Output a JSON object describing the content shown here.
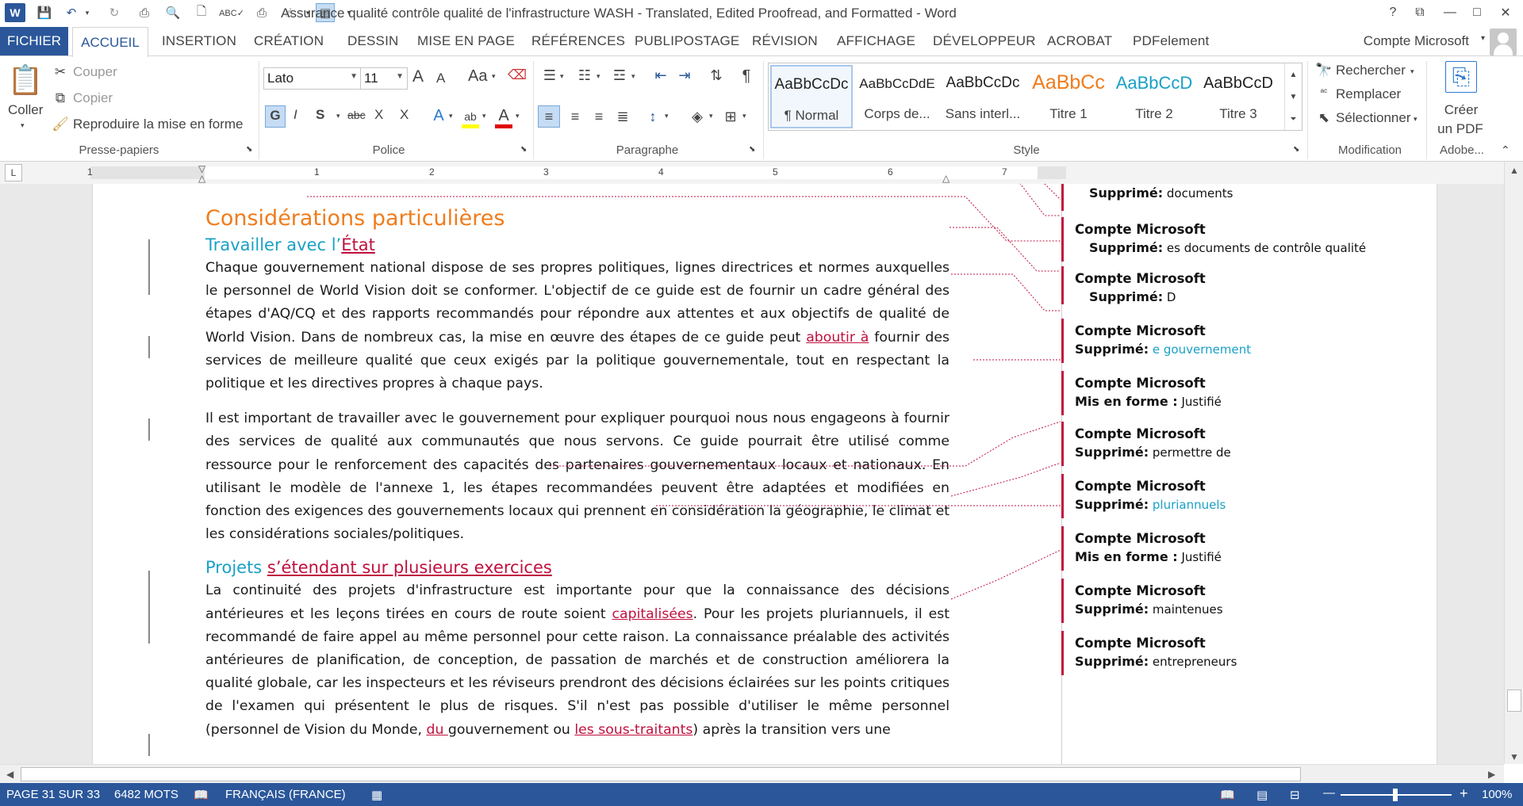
{
  "window": {
    "title": "Assurance qualité  contrôle qualité de l'infrastructure WASH - Translated, Edited Proofread, and Formatted - Word",
    "app_icon": "W",
    "help": "?",
    "restore": "⧉",
    "minimize": "—",
    "maximize": "□",
    "close": "✕"
  },
  "tabs": {
    "file": "FICHIER",
    "home": "ACCUEIL",
    "items": [
      "INSERTION",
      "CRÉATION",
      "DESSIN",
      "MISE EN PAGE",
      "RÉFÉRENCES",
      "PUBLIPOSTAGE",
      "RÉVISION",
      "AFFICHAGE",
      "DÉVELOPPEUR",
      "ACROBAT",
      "PDFelement"
    ],
    "account": "Compte Microsoft"
  },
  "clipboard": {
    "paste": "Coller",
    "cut": "Couper",
    "copy": "Copier",
    "format_painter": "Reproduire la mise en forme",
    "label": "Presse-papiers"
  },
  "font": {
    "name": "Lato",
    "size": "11",
    "grow": "A",
    "shrink": "A",
    "case": "Aa",
    "bold": "G",
    "italic": "I",
    "shadow": "S",
    "strike": "abc",
    "subscript": "X",
    "superscript": "X",
    "label": "Police"
  },
  "paragraph": {
    "label": "Paragraphe"
  },
  "styles": {
    "items": [
      {
        "sample": "AaBbCcDc",
        "name": "¶ Normal",
        "color": "#222222"
      },
      {
        "sample": "AaBbCcDdE",
        "name": "Corps de...",
        "color": "#222222"
      },
      {
        "sample": "AaBbCcDc",
        "name": "Sans interl...",
        "color": "#222222"
      },
      {
        "sample": "AaBbCc",
        "name": "Titre 1",
        "color": "#f07c1c"
      },
      {
        "sample": "AaBbCcD",
        "name": "Titre 2",
        "color": "#1aa0c6"
      },
      {
        "sample": "AaBbCcD",
        "name": "Titre 3",
        "color": "#222222"
      }
    ],
    "label": "Style"
  },
  "editing": {
    "find": "Rechercher",
    "replace": "Remplacer",
    "select": "Sélectionner",
    "label": "Modification"
  },
  "adobe": {
    "create_pdf_1": "Créer",
    "create_pdf_2": "un PDF",
    "label": "Adobe..."
  },
  "ruler": {
    "numbers": [
      "1",
      "1",
      "2",
      "3",
      "4",
      "5",
      "6",
      "7"
    ],
    "tab_selector": "L"
  },
  "document": {
    "heading1": "Considérations particulières",
    "heading2a_plain": "Travailler avec l’",
    "heading2a_ins": "État",
    "para1_a": "Chaque gouvernement national dispose de ses propres politiques, lignes directrices et normes auxquelles le personnel de World Vision doit se conformer. L'objectif de ce guide est de fournir un cadre général des étapes d'AQ/CQ et des rapports recommandés pour répondre aux attentes et aux objectifs de qualité de World Vision. Dans de nombreux cas, la mise en œuvre des étapes de ce guide peut ",
    "para1_ins": "aboutir à",
    "para1_b": " fournir des services de meilleure qualité que ceux exigés par la politique gouvernementale, tout en respectant la politique et les directives propres à chaque pays.",
    "para2": "Il est important de travailler avec le gouvernement pour expliquer pourquoi nous nous engageons à fournir des services de qualité aux communautés que nous servons. Ce guide pourrait être utilisé comme ressource pour le renforcement des capacités des partenaires gouvernementaux locaux et nationaux. En utilisant le modèle de l'annexe 1, les étapes recommandées peuvent être adaptées et modifiées en fonction des exigences des gouvernements locaux qui prennent en considération la géographie, le climat et les considérations sociales/politiques.",
    "heading2b_plain": "Projets ",
    "heading2b_ins": "s’étendant sur plusieurs exercices",
    "para3_a": "La continuité des projets d'infrastructure est importante pour que la connaissance des décisions antérieures et les leçons tirées en cours de route soient ",
    "para3_ins1": "capitalisées",
    "para3_b": ". Pour les projets pluriannuels, il est recommandé de faire appel au même personnel pour cette raison. La connaissance préalable des activités antérieures de planification, de conception, de passation de marchés et de construction améliorera la qualité globale, car les inspecteurs et les réviseurs prendront des décisions éclairées sur les points critiques de l'examen qui présentent le plus de risques. S'il n'est pas possible d'utiliser le même personnel (personnel de Vision du Monde, ",
    "para3_ins2": "du ",
    "para3_c": "gouvernement ou ",
    "para3_ins3": "les sous-traitants",
    "para3_d": ") après la transition vers une"
  },
  "balloons": [
    {
      "author": "",
      "kind": "Supprimé:",
      "text": "documents",
      "indent": true,
      "teal": false
    },
    {
      "author": "Compte Microsoft",
      "kind": "Supprimé:",
      "text": "es documents de contrôle qualité",
      "indent": true,
      "teal": false
    },
    {
      "author": "Compte Microsoft",
      "kind": "Supprimé:",
      "text": "D",
      "indent": true,
      "teal": false
    },
    {
      "author": "Compte Microsoft",
      "kind": "Supprimé:",
      "text": "e gouvernement",
      "indent": false,
      "teal": true
    },
    {
      "author": "Compte Microsoft",
      "kind": "Mis en forme :",
      "text": "Justifié",
      "indent": false,
      "teal": false
    },
    {
      "author": "Compte Microsoft",
      "kind": "Supprimé:",
      "text": "permettre de",
      "indent": false,
      "teal": false
    },
    {
      "author": "Compte Microsoft",
      "kind": "Supprimé:",
      "text": "pluriannuels",
      "indent": false,
      "teal": true
    },
    {
      "author": "Compte Microsoft",
      "kind": "Mis en forme :",
      "text": "Justifié",
      "indent": false,
      "teal": false
    },
    {
      "author": "Compte Microsoft",
      "kind": "Supprimé:",
      "text": "maintenues",
      "indent": false,
      "teal": false
    },
    {
      "author": "Compte Microsoft",
      "kind": "Supprimé:",
      "text": "entrepreneurs",
      "indent": false,
      "teal": false
    }
  ],
  "status": {
    "page": "PAGE 31 SUR 33",
    "words": "6482 MOTS",
    "language": "FRANÇAIS (FRANCE)",
    "zoom_minus": "—",
    "zoom_plus": "+",
    "zoom": "100%"
  },
  "colors": {
    "accent": "#2b579a",
    "heading1": "#f07c1c",
    "heading2": "#1aa0c6",
    "revision": "#c0103e"
  }
}
